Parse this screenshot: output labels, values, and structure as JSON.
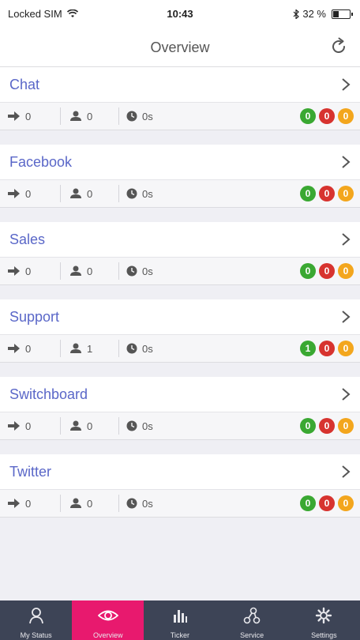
{
  "statusbar": {
    "carrier": "Locked SIM",
    "time": "10:43",
    "battery": "32 %"
  },
  "header": {
    "title": "Overview"
  },
  "groups": [
    {
      "name": "Chat",
      "inbound": "0",
      "agents": "0",
      "wait": "0s",
      "green": "0",
      "red": "0",
      "orange": "0"
    },
    {
      "name": "Facebook",
      "inbound": "0",
      "agents": "0",
      "wait": "0s",
      "green": "0",
      "red": "0",
      "orange": "0"
    },
    {
      "name": "Sales",
      "inbound": "0",
      "agents": "0",
      "wait": "0s",
      "green": "0",
      "red": "0",
      "orange": "0"
    },
    {
      "name": "Support",
      "inbound": "0",
      "agents": "1",
      "wait": "0s",
      "green": "1",
      "red": "0",
      "orange": "0"
    },
    {
      "name": "Switchboard",
      "inbound": "0",
      "agents": "0",
      "wait": "0s",
      "green": "0",
      "red": "0",
      "orange": "0"
    },
    {
      "name": "Twitter",
      "inbound": "0",
      "agents": "0",
      "wait": "0s",
      "green": "0",
      "red": "0",
      "orange": "0"
    }
  ],
  "tabs": [
    {
      "label": "My Status",
      "icon": "person-icon"
    },
    {
      "label": "Overview",
      "icon": "eye-icon",
      "active": true
    },
    {
      "label": "Ticker",
      "icon": "bar-chart-icon"
    },
    {
      "label": "Service",
      "icon": "network-icon"
    },
    {
      "label": "Settings",
      "icon": "gear-icon"
    }
  ],
  "colors": {
    "accent": "#e8196e",
    "link": "#5a67c8",
    "tabbar": "#3d4456",
    "green": "#3aa832",
    "red": "#d7332f",
    "orange": "#f3a61d"
  }
}
